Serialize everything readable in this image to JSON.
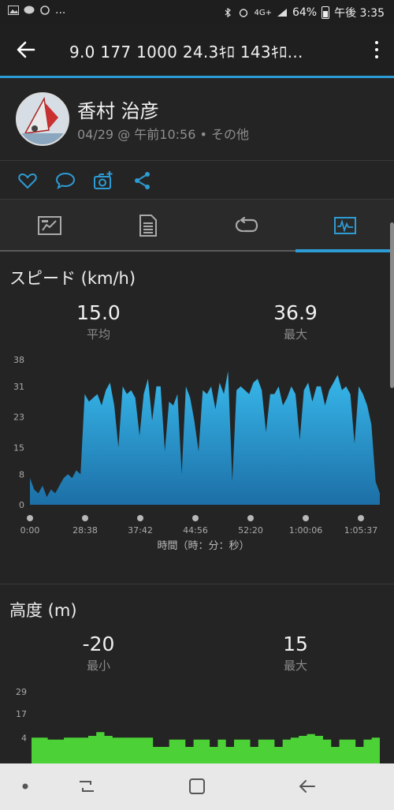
{
  "status_bar": {
    "left_icons": [
      "image-icon",
      "message-icon",
      "sync-icon"
    ],
    "left_more": "...",
    "network": "4G+",
    "battery": "64%",
    "time": "午後 3:35"
  },
  "app_bar": {
    "title": "9.0  177   1000  24.3ｷﾛ  143ｷﾛ…"
  },
  "activity": {
    "name": "香村 治彦",
    "meta": "04/29 @ 午前10:56 • その他"
  },
  "actions": [
    "like-icon",
    "comment-icon",
    "add-photo-icon",
    "share-icon"
  ],
  "tabs": [
    "overview-tab",
    "details-tab",
    "laps-tab",
    "charts-tab"
  ],
  "speed": {
    "title": "スピード (km/h)",
    "avg_value": "15.0",
    "avg_label": "平均",
    "max_value": "36.9",
    "max_label": "最大",
    "y_ticks": [
      "38",
      "31",
      "23",
      "15",
      "8",
      "0"
    ],
    "x_ticks": [
      "0:00",
      "28:38",
      "37:42",
      "44:56",
      "52:20",
      "1:00:06",
      "1:05:37"
    ],
    "x_title": "時間（時：分：秒）"
  },
  "elevation": {
    "title": "高度 (m)",
    "min_value": "-20",
    "min_label": "最小",
    "max_value": "15",
    "max_label": "最大",
    "y_ticks": [
      "29",
      "17",
      "4"
    ]
  },
  "colors": {
    "accent": "#2d9bd4",
    "speed_fill_top": "#35b3e6",
    "speed_fill_bottom": "#1f77ad",
    "elevation_fill": "#4cd137"
  },
  "chart_data": [
    {
      "type": "area",
      "title": "スピード (km/h)",
      "xlabel": "時間（時：分：秒）",
      "ylabel": "",
      "ylim": [
        0,
        38
      ],
      "x_tick_labels": [
        "0:00",
        "28:38",
        "37:42",
        "44:56",
        "52:20",
        "1:00:06",
        "1:05:37"
      ],
      "y_tick_labels": [
        "0",
        "8",
        "15",
        "23",
        "31",
        "38"
      ],
      "series": [
        {
          "values": [
            7,
            4,
            3,
            5,
            2,
            4,
            3,
            5,
            7,
            8,
            7,
            9,
            8,
            29,
            27,
            28,
            29,
            26,
            30,
            32,
            26,
            15,
            31,
            29,
            30,
            28,
            18,
            29,
            33,
            22,
            31,
            31,
            14,
            27,
            26,
            29,
            8,
            31,
            28,
            22,
            14,
            30,
            29,
            31,
            25,
            32,
            29,
            35,
            6,
            30,
            31,
            30,
            29,
            32,
            33,
            30,
            19,
            29,
            29,
            31,
            26,
            28,
            31,
            29,
            17,
            30,
            32,
            27,
            31,
            31,
            26,
            30,
            32,
            34,
            30,
            31,
            29,
            16,
            31,
            29,
            26,
            21,
            6,
            3
          ]
        }
      ],
      "avg": 15.0,
      "max": 36.9
    },
    {
      "type": "area",
      "title": "高度 (m)",
      "ylim": [
        -10,
        29
      ],
      "y_tick_labels": [
        "4",
        "17",
        "29"
      ],
      "series": [
        {
          "values": [
            4,
            4,
            3,
            3,
            4,
            4,
            4,
            5,
            7,
            5,
            4,
            4,
            4,
            4,
            4,
            -1,
            -1,
            3,
            3,
            -1,
            3,
            3,
            -1,
            3,
            -1,
            3,
            3,
            -1,
            3,
            3,
            -1,
            3,
            4,
            5,
            6,
            5,
            3,
            -1,
            3,
            3,
            -1,
            3,
            4,
            4
          ]
        }
      ],
      "min": -20,
      "max": 15
    }
  ],
  "nav": [
    "recents-button",
    "home-button",
    "back-button"
  ]
}
